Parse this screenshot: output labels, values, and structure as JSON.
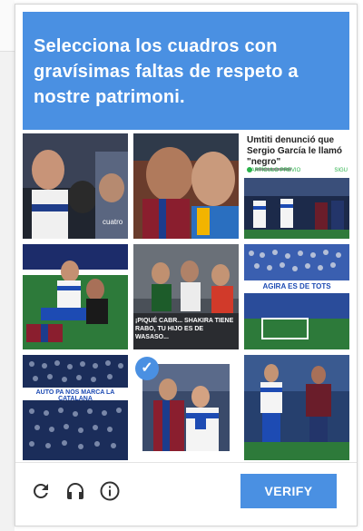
{
  "challenge": {
    "instruction": "Selecciona los cuadros con gravísimas faltas de respeto a nostre patrimoni."
  },
  "tiles": [
    {
      "id": 1,
      "selected": false,
      "overlay_text": "cuatro"
    },
    {
      "id": 2,
      "selected": false
    },
    {
      "id": 3,
      "selected": false,
      "headline": "Umtiti denunció que Sergio García le llamó \"negro\"",
      "nav_left": "« ARTÍCULO PREVIO",
      "nav_right": "SIGU"
    },
    {
      "id": 4,
      "selected": false
    },
    {
      "id": 5,
      "selected": false,
      "caption": "¡PIQUÉ CABR... SHAKIRA TIENE RABO, TU HIJO ES DE WASASO..."
    },
    {
      "id": 6,
      "selected": false,
      "banner": "AGIRA ES DE TOTS"
    },
    {
      "id": 7,
      "selected": false,
      "banner": "AUTO PA NOS MARCA LA CATALANA"
    },
    {
      "id": 8,
      "selected": true
    },
    {
      "id": 9,
      "selected": false
    }
  ],
  "footer": {
    "verify_label": "VERIFY",
    "icons": [
      "reload-icon",
      "audio-icon",
      "info-icon"
    ]
  },
  "colors": {
    "accent": "#4a90e2"
  }
}
